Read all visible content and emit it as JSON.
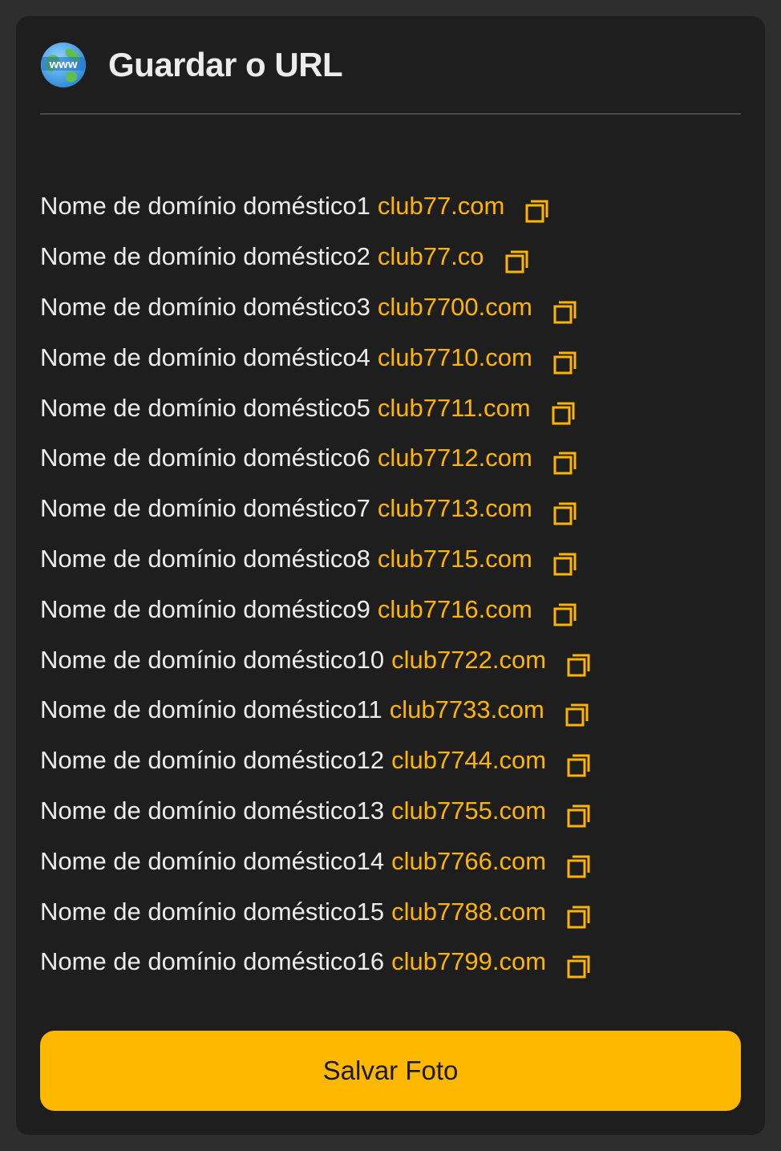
{
  "header": {
    "icon": "globe-www-icon",
    "globe_text": "www",
    "title": "Guardar o URL"
  },
  "domains": [
    {
      "label": "Nome de domínio doméstico1",
      "url": "club77.com"
    },
    {
      "label": "Nome de domínio doméstico2",
      "url": "club77.co"
    },
    {
      "label": "Nome de domínio doméstico3",
      "url": "club7700.com"
    },
    {
      "label": "Nome de domínio doméstico4",
      "url": "club7710.com"
    },
    {
      "label": "Nome de domínio doméstico5",
      "url": "club7711.com"
    },
    {
      "label": "Nome de domínio doméstico6",
      "url": "club7712.com"
    },
    {
      "label": "Nome de domínio doméstico7",
      "url": "club7713.com"
    },
    {
      "label": "Nome de domínio doméstico8",
      "url": "club7715.com"
    },
    {
      "label": "Nome de domínio doméstico9",
      "url": "club7716.com"
    },
    {
      "label": "Nome de domínio doméstico10",
      "url": "club7722.com"
    },
    {
      "label": "Nome de domínio doméstico11",
      "url": "club7733.com"
    },
    {
      "label": "Nome de domínio doméstico12",
      "url": "club7744.com"
    },
    {
      "label": "Nome de domínio doméstico13",
      "url": "club7755.com"
    },
    {
      "label": "Nome de domínio doméstico14",
      "url": "club7766.com"
    },
    {
      "label": "Nome de domínio doméstico15",
      "url": "club7788.com"
    },
    {
      "label": "Nome de domínio doméstico16",
      "url": "club7799.com"
    }
  ],
  "copy_icon": "copy-icon",
  "save_button": {
    "label": "Salvar Foto"
  },
  "colors": {
    "background": "#2e2e2e",
    "card": "#1e1e1e",
    "text": "#ececec",
    "accent": "#ffb400",
    "button": "#ffb800"
  }
}
